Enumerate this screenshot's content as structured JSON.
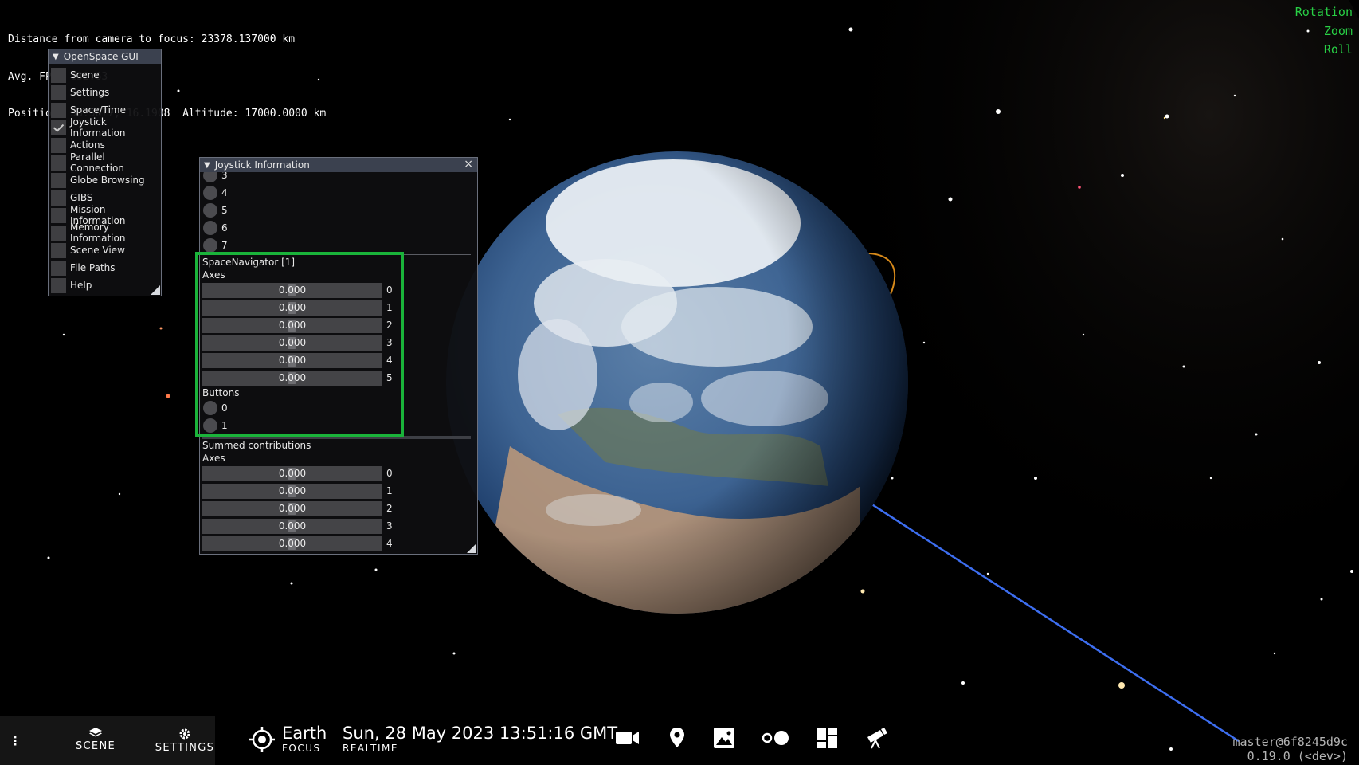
{
  "hud": {
    "distance": "Distance from camera to focus: 23378.137000 km",
    "fps": "Avg. FPS: 132.63",
    "position": "Position: 58.5877, 16.1908  Altitude: 17000.0000 km",
    "modes": [
      "Rotation",
      "Zoom",
      "Roll"
    ],
    "version_branch": "master@6f8245d9c",
    "version_number": "0.19.0 (<dev>)"
  },
  "colors": {
    "mode_text": "#28d045",
    "highlight": "#1ab33a",
    "window_title": "#3b414f"
  },
  "main_gui": {
    "title": "OpenSpace GUI",
    "items": [
      {
        "label": "Scene",
        "checked": false
      },
      {
        "label": "Settings",
        "checked": false
      },
      {
        "label": "Space/Time",
        "checked": false
      },
      {
        "label": "Joystick Information",
        "checked": true
      },
      {
        "label": "Actions",
        "checked": false
      },
      {
        "label": "Parallel Connection",
        "checked": false
      },
      {
        "label": "Globe Browsing",
        "checked": false
      },
      {
        "label": "GIBS",
        "checked": false
      },
      {
        "label": "Mission Information",
        "checked": false
      },
      {
        "label": "Memory Information",
        "checked": false
      },
      {
        "label": "Scene View",
        "checked": false
      },
      {
        "label": "File Paths",
        "checked": false
      },
      {
        "label": "Help",
        "checked": false
      }
    ]
  },
  "joystick": {
    "title": "Joystick Information",
    "prev_buttons": [
      "3",
      "4",
      "5",
      "6",
      "7"
    ],
    "device_name": "SpaceNavigator [1]",
    "axes_label": "Axes",
    "axes": [
      {
        "value": "0.000",
        "index": "0"
      },
      {
        "value": "0.000",
        "index": "1"
      },
      {
        "value": "0.000",
        "index": "2"
      },
      {
        "value": "0.000",
        "index": "3"
      },
      {
        "value": "0.000",
        "index": "4"
      },
      {
        "value": "0.000",
        "index": "5"
      }
    ],
    "buttons_label": "Buttons",
    "buttons": [
      "0",
      "1"
    ],
    "summed_label": "Summed contributions",
    "summed_axes_label": "Axes",
    "summed_axes": [
      {
        "value": "0.000",
        "index": "0"
      },
      {
        "value": "0.000",
        "index": "1"
      },
      {
        "value": "0.000",
        "index": "2"
      },
      {
        "value": "0.000",
        "index": "3"
      },
      {
        "value": "0.000",
        "index": "4"
      }
    ]
  },
  "bottom_bar": {
    "scene_label": "SCENE",
    "settings_label": "SETTINGS",
    "focus_name": "Earth",
    "focus_label": "FOCUS",
    "datetime": "Sun, 28 May 2023 13:51:16 GMT",
    "time_mode": "REALTIME",
    "tools": [
      "camera-icon",
      "location-pin-icon",
      "image-icon",
      "dots-icon",
      "dashboard-icon",
      "telescope-icon"
    ]
  }
}
